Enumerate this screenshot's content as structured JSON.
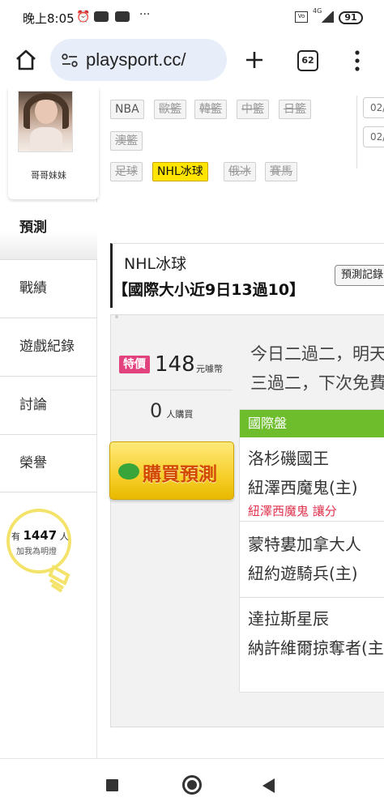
{
  "status_bar": {
    "time": "晚上8:05",
    "more": "···",
    "battery": "91",
    "network": "4G"
  },
  "browser": {
    "url": "playsport.cc/",
    "tab_count": "62"
  },
  "sidebar": {
    "profile_name": "哥哥妹妹",
    "active_item": "預測",
    "items": [
      {
        "label": "戰績"
      },
      {
        "label": "遊戲紀錄"
      },
      {
        "label": "討論"
      },
      {
        "label": "榮譽"
      }
    ],
    "fans": {
      "prefix": "有",
      "count": "1447",
      "suffix": "人",
      "cta": "加我為明燈"
    }
  },
  "filters": {
    "chips": [
      {
        "label": "NBA"
      },
      {
        "label": "歐籃"
      },
      {
        "label": "韓籃"
      },
      {
        "label": "中籃"
      },
      {
        "label": "日籃"
      },
      {
        "label": "澳籃"
      },
      {
        "label": "足球"
      },
      {
        "label": "NHL冰球"
      },
      {
        "label": "俄冰"
      },
      {
        "label": "賽馬"
      }
    ],
    "dates": [
      "02/",
      "02/"
    ]
  },
  "prediction": {
    "category": "NHL冰球",
    "title": "【國際大小近9日13過10】",
    "record_button": "預測記錄",
    "special_tag": "特價",
    "price": "148",
    "price_unit": "元噱幣",
    "buyers": "0",
    "buyers_unit": "人購買",
    "buy_button": "購買預測",
    "description_line1": "今日二過二，明天",
    "description_line2": "三過二，下次免費"
  },
  "market": {
    "header": "國際盤",
    "matches": [
      {
        "away": "洛杉磯國王",
        "home": "紐澤西魔鬼(主)",
        "note": "紐澤西魔鬼 讓分"
      },
      {
        "away": "蒙特婁加拿大人",
        "home": "紐約遊騎兵(主)"
      },
      {
        "away": "達拉斯星辰",
        "home": "納許維爾掠奪者(主)"
      }
    ]
  }
}
